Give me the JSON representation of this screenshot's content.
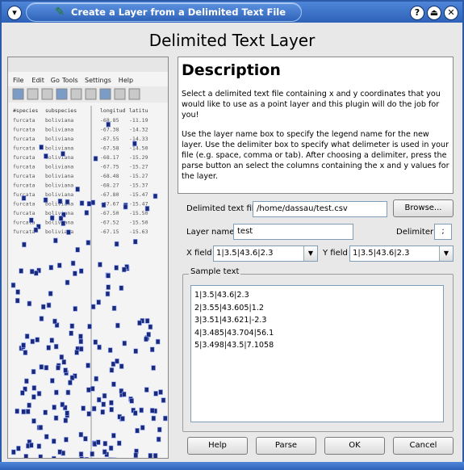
{
  "window": {
    "title": "Create a Layer from a Delimited Text File",
    "menu_icon": "chevron-down-icon",
    "help_icon": "question-icon",
    "shade_icon": "shade-icon",
    "close_icon": "close-icon",
    "app_icon": "qgis-icon"
  },
  "heading": "Delimited Text Layer",
  "preview": {
    "menu_items": [
      "File",
      "Edit",
      "Go",
      "Tools",
      "Settings",
      "Help"
    ],
    "columns": [
      "#species",
      "subspecies",
      "longitud",
      "latitu"
    ],
    "rows": [
      [
        "furcata",
        "boliviana",
        "-68.85",
        "-11.19"
      ],
      [
        "furcata",
        "boliviana",
        "-67.38",
        "-14.32"
      ],
      [
        "furcata",
        "boliviana",
        "-67.55",
        "-14.33"
      ],
      [
        "furcata",
        "boliviana",
        "-67.58",
        "-14.50"
      ],
      [
        "furcata",
        "boliviana",
        "-68.17",
        "-15.29"
      ],
      [
        "furcata",
        "boliviana",
        "-67.75",
        "-15.27"
      ],
      [
        "furcata",
        "boliviana",
        "-68.48",
        "-15.27"
      ],
      [
        "furcata",
        "boliviana",
        "-68.27",
        "-15.37"
      ],
      [
        "furcata",
        "boliviana",
        "-67.80",
        "-15.47"
      ],
      [
        "furcata",
        "boliviana",
        "-67.67",
        "-15.47"
      ],
      [
        "furcata",
        "boliviana",
        "-67.50",
        "-15.50"
      ],
      [
        "furcata",
        "boliviana",
        "-67.52",
        "-15.50"
      ],
      [
        "furcata",
        "boliviana",
        "-67.15",
        "-15.63"
      ]
    ]
  },
  "description": {
    "title": "Description",
    "para1": "Select a delimited text file containing x and y coordinates that you would like to use as a point layer and this plugin will do the job for you!",
    "para2": "Use the layer name box to specify the legend name for the new layer. Use the delimiter box to specify what delimeter is used in your file (e.g. space, comma or tab). After choosing a delimiter, press the parse button an select the columns containing the x and y values for the layer."
  },
  "form": {
    "file_label": "Delimited text file",
    "file_value": "/home/dassau/test.csv",
    "browse_label": "Browse...",
    "layer_label": "Layer name",
    "layer_value": "test",
    "delimiter_label": "Delimiter",
    "delimiter_value": ";",
    "xfield_label": "X field",
    "xfield_value": "1|3.5|43.6|2.3",
    "yfield_label": "Y field",
    "yfield_value": "1|3.5|43.6|2.3"
  },
  "sample": {
    "legend": "Sample text",
    "lines": [
      "1|3.5|43.6|2.3",
      "2|3.55|43.605|1.2",
      "3|3.51|43.621|-2.3",
      "4|3.485|43.704|56.1",
      "5|3.498|43.5|7.1058"
    ]
  },
  "buttons": {
    "help": "Help",
    "parse": "Parse",
    "ok": "OK",
    "cancel": "Cancel"
  }
}
